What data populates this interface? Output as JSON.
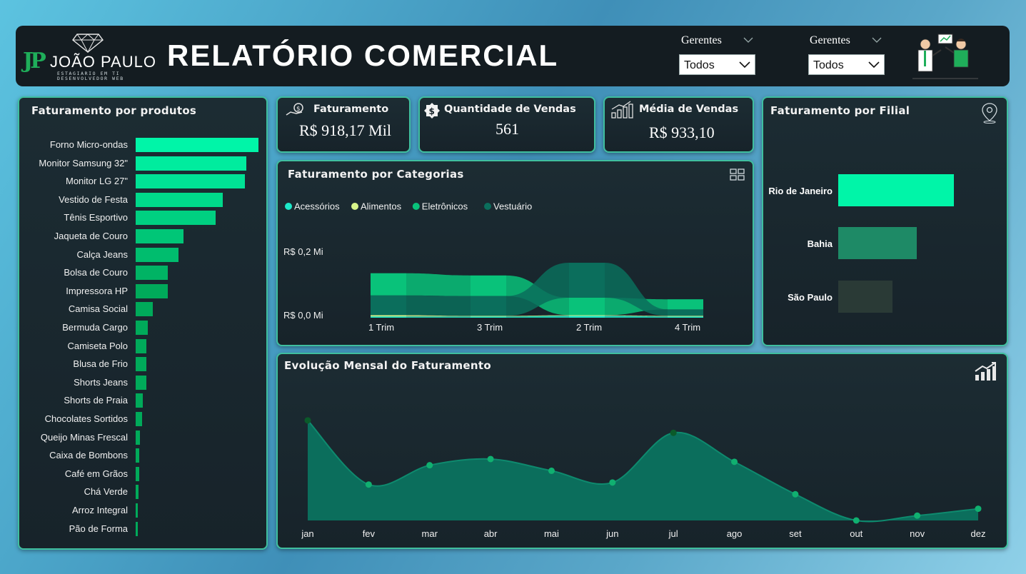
{
  "header": {
    "logo_initials": "JP",
    "logo_name": "JOÃO PAULO",
    "logo_sub1": "ESTAGIARIO EM TI",
    "logo_sub2": "DESENVOLVEDOR WEB",
    "title": "RELATÓRIO COMERCIAL",
    "filters": [
      {
        "label": "Gerentes",
        "value": "Todos"
      },
      {
        "label": "Gerentes",
        "value": "Todos"
      }
    ]
  },
  "kpis": {
    "faturamento": {
      "title": "Faturamento",
      "value": "R$ 918,17 Mil"
    },
    "quantidade": {
      "title": "Quantidade de Vendas",
      "value": "561"
    },
    "media": {
      "title": "Média de Vendas",
      "value": "R$ 933,10"
    }
  },
  "products_panel": {
    "title": "Faturamento por produtos",
    "color_primary": "#00f5a8",
    "items": [
      {
        "label": "Forno Micro-ondas",
        "value": 100
      },
      {
        "label": "Monitor Samsung 32\"",
        "value": 90
      },
      {
        "label": "Monitor LG 27\"",
        "value": 89
      },
      {
        "label": "Vestido de Festa",
        "value": 71
      },
      {
        "label": "Tênis Esportivo",
        "value": 65
      },
      {
        "label": "Jaqueta de Couro",
        "value": 39
      },
      {
        "label": "Calça Jeans",
        "value": 35
      },
      {
        "label": "Bolsa de Couro",
        "value": 26
      },
      {
        "label": "Impressora HP",
        "value": 26
      },
      {
        "label": "Camisa Social",
        "value": 14
      },
      {
        "label": "Bermuda Cargo",
        "value": 10
      },
      {
        "label": "Camiseta Polo",
        "value": 9
      },
      {
        "label": "Blusa de Frio",
        "value": 9
      },
      {
        "label": "Shorts Jeans",
        "value": 9
      },
      {
        "label": "Shorts de Praia",
        "value": 6
      },
      {
        "label": "Chocolates Sortidos",
        "value": 5
      },
      {
        "label": "Queijo Minas Frescal",
        "value": 3.5
      },
      {
        "label": "Caixa de Bombons",
        "value": 3
      },
      {
        "label": "Café em Grãos",
        "value": 3
      },
      {
        "label": "Chá Verde",
        "value": 2.5
      },
      {
        "label": "Arroz Integral",
        "value": 2
      },
      {
        "label": "Pão de Forma",
        "value": 1.5
      }
    ]
  },
  "categories_panel": {
    "title": "Faturamento por Categorias",
    "legend": [
      {
        "name": "Acessórios",
        "color": "#1de9c9"
      },
      {
        "name": "Alimentos",
        "color": "#d8f58a"
      },
      {
        "name": "Eletrônicos",
        "color": "#09c27a"
      },
      {
        "name": "Vestuário",
        "color": "#0b6e5c"
      }
    ],
    "y_ticks": [
      "R$ 0,2 Mi",
      "R$ 0,0 Mi"
    ],
    "x_ticks": [
      "1 Trim",
      "3 Trim",
      "2 Trim",
      "4 Trim"
    ]
  },
  "branch_panel": {
    "title": "Faturamento por Filial",
    "items": [
      {
        "label": "Rio de Janeiro",
        "value": 100,
        "color": "#00f5a8"
      },
      {
        "label": "Bahia",
        "value": 68,
        "color": "#1e8a66"
      },
      {
        "label": "São Paulo",
        "value": 47,
        "color": "#2a3a36"
      }
    ]
  },
  "monthly_panel": {
    "title": "Evolução Mensal do Faturamento",
    "months": [
      "jan",
      "fev",
      "mar",
      "abr",
      "mai",
      "jun",
      "jul",
      "ago",
      "set",
      "out",
      "nov",
      "dez"
    ]
  },
  "chart_data": [
    {
      "type": "bar",
      "title": "Faturamento por produtos",
      "orientation": "horizontal",
      "categories": [
        "Forno Micro-ondas",
        "Monitor Samsung 32\"",
        "Monitor LG 27\"",
        "Vestido de Festa",
        "Tênis Esportivo",
        "Jaqueta de Couro",
        "Calça Jeans",
        "Bolsa de Couro",
        "Impressora HP",
        "Camisa Social",
        "Bermuda Cargo",
        "Camiseta Polo",
        "Blusa de Frio",
        "Shorts Jeans",
        "Shorts de Praia",
        "Chocolates Sortidos",
        "Queijo Minas Frescal",
        "Caixa de Bombons",
        "Café em Grãos",
        "Chá Verde",
        "Arroz Integral",
        "Pão de Forma"
      ],
      "values": [
        100,
        90,
        89,
        71,
        65,
        39,
        35,
        26,
        26,
        14,
        10,
        9,
        9,
        9,
        6,
        5,
        3.5,
        3,
        3,
        2.5,
        2,
        1.5
      ]
    },
    {
      "type": "area",
      "title": "Faturamento por Categorias",
      "categories": [
        "1 Trim",
        "3 Trim",
        "2 Trim",
        "4 Trim"
      ],
      "series": [
        {
          "name": "Acessórios",
          "values": [
            0.004,
            0.004,
            0.006,
            0.004
          ]
        },
        {
          "name": "Alimentos",
          "values": [
            0.004,
            0.002,
            0.002,
            0.002
          ]
        },
        {
          "name": "Eletrônicos",
          "values": [
            0.07,
            0.065,
            0.055,
            0.032
          ]
        },
        {
          "name": "Vestuário",
          "values": [
            0.062,
            0.062,
            0.11,
            0.02
          ]
        }
      ],
      "yticks": [
        "R$ 0,2 Mi",
        "R$ 0,0 Mi"
      ]
    },
    {
      "type": "bar",
      "title": "Faturamento por Filial",
      "orientation": "horizontal",
      "categories": [
        "Rio de Janeiro",
        "Bahia",
        "São Paulo"
      ],
      "values": [
        100,
        68,
        47
      ]
    },
    {
      "type": "area",
      "title": "Evolução Mensal do Faturamento",
      "categories": [
        "jan",
        "fev",
        "mar",
        "abr",
        "mai",
        "jun",
        "jul",
        "ago",
        "set",
        "out",
        "nov",
        "dez"
      ],
      "values": [
        145,
        52,
        80,
        89,
        72,
        55,
        127,
        85,
        38,
        0,
        7,
        17
      ],
      "ylim": [
        0,
        150
      ]
    }
  ]
}
